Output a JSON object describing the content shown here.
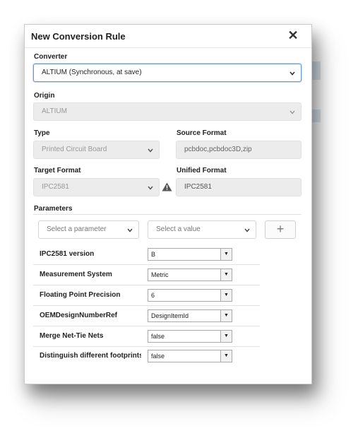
{
  "dialog": {
    "title": "New Conversion Rule",
    "close_glyph": "✕"
  },
  "converter": {
    "label": "Converter",
    "value": "ALTIUM (Synchronous, at save)"
  },
  "origin": {
    "label": "Origin",
    "value": "ALTIUM"
  },
  "type": {
    "label": "Type",
    "value": "Printed Circuit Board"
  },
  "source_format": {
    "label": "Source Format",
    "value": "pcbdoc,pcbdoc3D,zip"
  },
  "target_format": {
    "label": "Target Format",
    "value": "IPC2581"
  },
  "unified_format": {
    "label": "Unified Format",
    "value": "IPC2581"
  },
  "parameters": {
    "label": "Parameters",
    "parameter_placeholder": "Select a parameter",
    "value_placeholder": "Select a value",
    "add_glyph": "+",
    "rows": [
      {
        "name": "IPC2581 version",
        "value": "B"
      },
      {
        "name": "Measurement System",
        "value": "Metric"
      },
      {
        "name": "Floating Point Precision",
        "value": "6"
      },
      {
        "name": "OEMDesignNumberRef",
        "value": "DesignItemId"
      },
      {
        "name": "Merge Net-Tie Nets",
        "value": "false"
      },
      {
        "name": "Distinguish different footprints",
        "value": "false"
      }
    ]
  },
  "icons": {
    "dropdown": "chevron-down-icon",
    "warning": "warning-icon",
    "close": "close-icon",
    "add": "plus-icon"
  },
  "colors": {
    "focus_border": "#6b99c9",
    "disabled_bg": "#ececec"
  }
}
